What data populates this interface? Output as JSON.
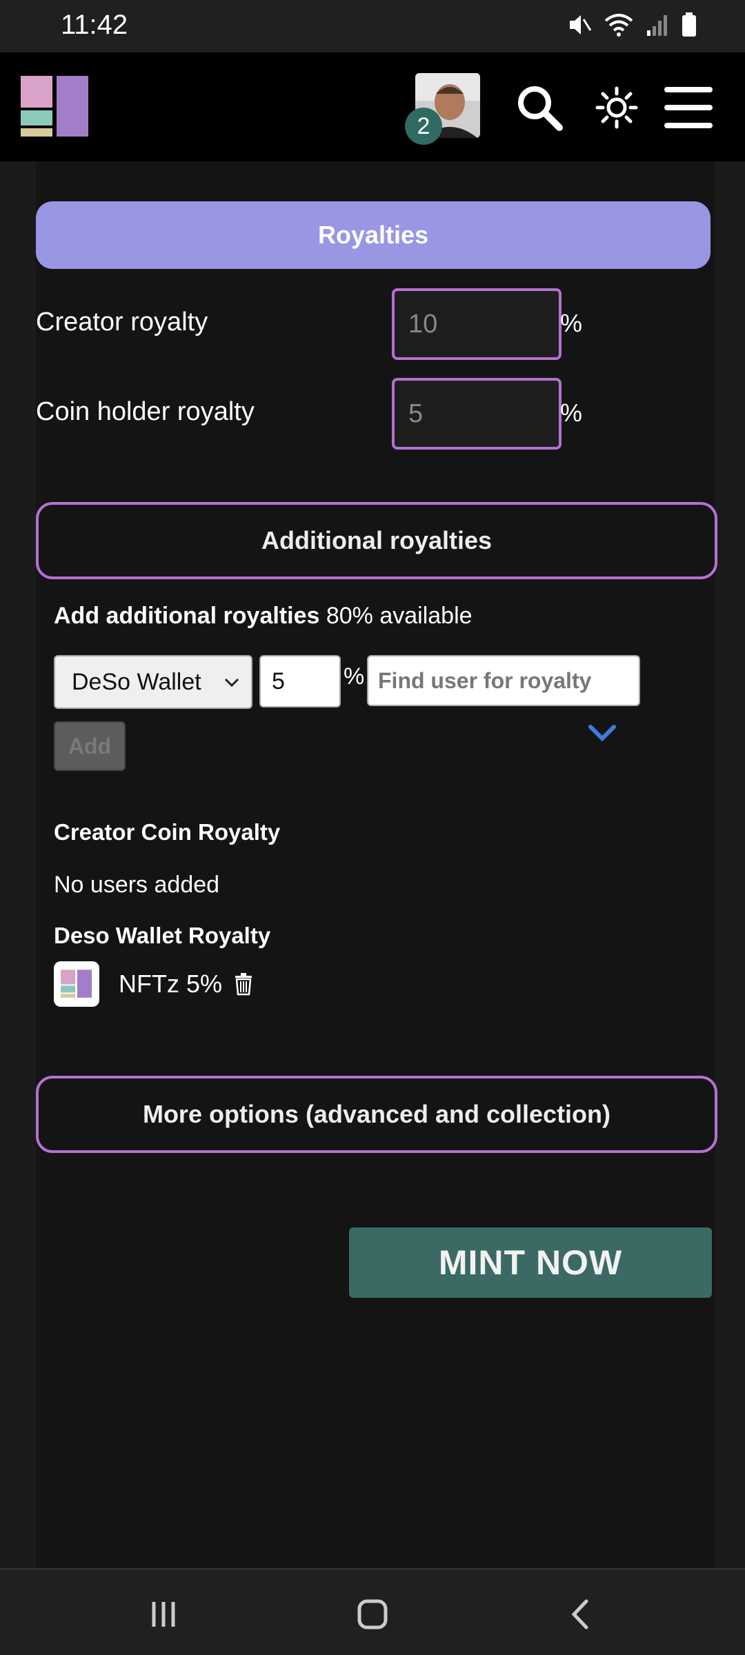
{
  "status_bar": {
    "time": "11:42",
    "icons": [
      "mute-icon",
      "wifi-icon",
      "signal-icon",
      "battery-icon"
    ]
  },
  "header": {
    "logo": "nftz-logo",
    "notification_count": "2",
    "icons": [
      "search-icon",
      "theme-toggle-icon",
      "menu-icon"
    ]
  },
  "royalties": {
    "section_label": "Royalties",
    "creator_label": "Creator royalty",
    "creator_placeholder": "10",
    "coin_holder_label": "Coin holder royalty",
    "coin_holder_placeholder": "5",
    "percent_sign": "%"
  },
  "additional": {
    "button_label": "Additional royalties",
    "heading": "Add additional royalties",
    "available": "80% available",
    "wallet_select": "DeSo Wallet",
    "percent_value": "5",
    "percent_sign": "%",
    "find_placeholder": "Find user for royalty",
    "add_label": "Add"
  },
  "creator_coin_royalty": {
    "title": "Creator Coin Royalty",
    "empty_text": "No users added"
  },
  "deso_wallet_royalty": {
    "title": "Deso Wallet Royalty",
    "items": [
      {
        "name": "NFTz 5%"
      }
    ]
  },
  "more_options_label": "More options (advanced and collection)",
  "mint_label": "MINT NOW",
  "colors": {
    "accent_purple": "#9996e4",
    "outline_purple": "#b670d0",
    "mint_green": "#3a6a63",
    "link_blue": "#3b7de0"
  }
}
